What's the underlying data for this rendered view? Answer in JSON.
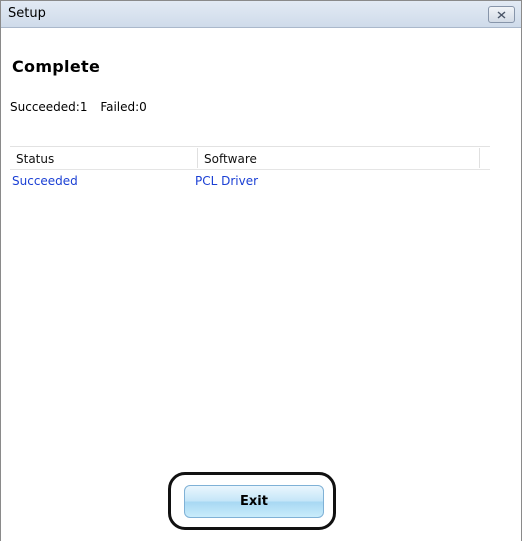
{
  "window": {
    "title": "Setup",
    "close_icon": "close-x-icon"
  },
  "page": {
    "heading": "Complete"
  },
  "summary": {
    "succeeded": "Succeeded:1",
    "failed": "Failed:0"
  },
  "results": {
    "columns": [
      "Status",
      "Software"
    ],
    "rows": [
      {
        "status": "Succeeded",
        "software": "PCL Driver"
      }
    ]
  },
  "actions": {
    "exit_label": "Exit"
  },
  "colors": {
    "link_blue": "#1a3fd4",
    "title_bar": "#d6e1ee",
    "button_blue": "#bfe4f8"
  }
}
